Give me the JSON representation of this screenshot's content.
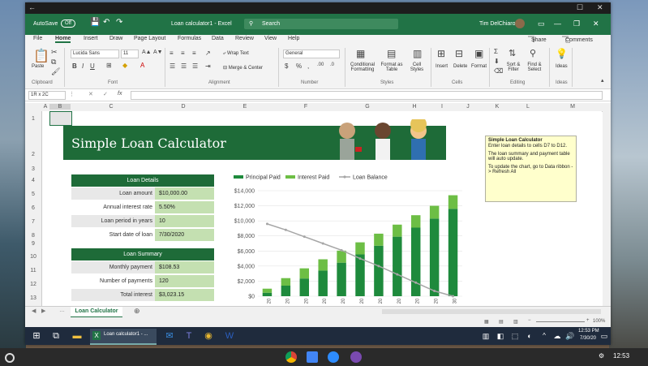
{
  "window": {
    "title": "Loan calculator1 - Excel",
    "autosave_label": "AutoSave",
    "autosave_state": "Off",
    "search_placeholder": "Search",
    "user_name": "Tim DelChiaro"
  },
  "menu": {
    "items": [
      "File",
      "Home",
      "Insert",
      "Draw",
      "Page Layout",
      "Formulas",
      "Data",
      "Review",
      "View",
      "Help"
    ],
    "share": "Share",
    "comments": "Comments"
  },
  "ribbon": {
    "paste": "Paste",
    "font_name": "Lucida Sans",
    "font_size": "11",
    "wrap_text": "Wrap Text",
    "merge_center": "Merge & Center",
    "number_format": "General",
    "conditional": "Conditional Formatting",
    "format_table": "Format as Table",
    "cell_styles": "Cell Styles",
    "insert": "Insert",
    "delete": "Delete",
    "format": "Format",
    "sort_filter": "Sort & Filter",
    "find_select": "Find & Select",
    "ideas": "Ideas",
    "groups": [
      "Clipboard",
      "Font",
      "Alignment",
      "Number",
      "Styles",
      "Cells",
      "Editing",
      "Ideas"
    ]
  },
  "formula_bar": {
    "name_box": "1R x 2C",
    "fx": "fx"
  },
  "columns": [
    "A",
    "B",
    "C",
    "D",
    "E",
    "F",
    "G",
    "H",
    "I",
    "J",
    "K",
    "L",
    "M"
  ],
  "rows": [
    "1",
    "2",
    "3",
    "4",
    "5",
    "6",
    "7",
    "8",
    "9",
    "10",
    "11",
    "12",
    "13"
  ],
  "sheet": {
    "title": "Simple Loan Calculator",
    "loan_details_header": "Loan Details",
    "loan_details": [
      {
        "label": "Loan amount",
        "value": "$10,000.00"
      },
      {
        "label": "Annual interest rate",
        "value": "5.50%"
      },
      {
        "label": "Loan period in years",
        "value": "10"
      },
      {
        "label": "Start date of loan",
        "value": "7/30/2020"
      }
    ],
    "loan_summary_header": "Loan Summary",
    "loan_summary": [
      {
        "label": "Monthly payment",
        "value": "$108.53"
      },
      {
        "label": "Number of payments",
        "value": "120"
      },
      {
        "label": "Total interest",
        "value": "$3,023.15"
      }
    ]
  },
  "note": {
    "title": "Simple Loan Calculator",
    "p1": "Enter loan details to cells D7 to D12.",
    "p2": "The loan summary and payment table will auto update.",
    "p3": "To update the chart, go to Data ribbon -> Refresh All"
  },
  "chart_data": {
    "type": "bar",
    "title": "",
    "xlabel": "",
    "ylabel": "",
    "ylim": [
      0,
      14000
    ],
    "y_ticks": [
      "$0",
      "$2,000",
      "$4,000",
      "$6,000",
      "$8,000",
      "$10,000",
      "$12,000",
      "$14,000"
    ],
    "categories": [
      "20",
      "20",
      "20",
      "20",
      "20",
      "20",
      "20",
      "20",
      "20",
      "20",
      "30"
    ],
    "series": [
      {
        "name": "Principal Paid",
        "color": "#1e8a3c",
        "values": [
          460,
          1400,
          2350,
          3400,
          4450,
          5550,
          6700,
          7900,
          9100,
          10300,
          11600
        ]
      },
      {
        "name": "Interest Paid",
        "color": "#6dbe45",
        "values": [
          540,
          1000,
          1350,
          1500,
          1600,
          1600,
          1600,
          1600,
          1650,
          1700,
          1800
        ]
      },
      {
        "name": "Loan Balance",
        "color": "#a6a6a6",
        "values": [
          9600,
          8800,
          7900,
          7000,
          6100,
          5000,
          4000,
          2900,
          1800,
          700,
          0
        ]
      }
    ]
  },
  "sheet_tab": "Loan Calculator",
  "status": {
    "zoom": "100%"
  },
  "taskbar": {
    "active_app": "Loan calculator1 - ...",
    "time": "12:53 PM",
    "date": "7/30/20"
  },
  "shelf": {
    "time": "12:53"
  }
}
